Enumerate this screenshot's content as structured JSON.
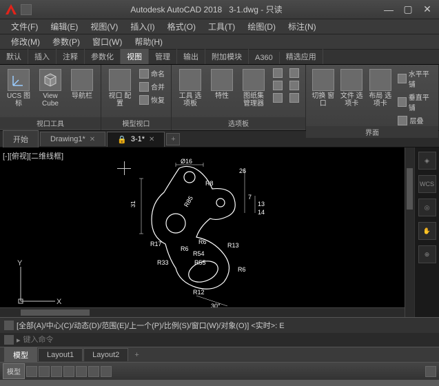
{
  "title": {
    "app": "Autodesk AutoCAD 2018",
    "file": "3-1.dwg",
    "mode": "只读"
  },
  "menus_row1": [
    "文件(F)",
    "编辑(E)",
    "视图(V)",
    "插入(I)",
    "格式(O)",
    "工具(T)",
    "绘图(D)",
    "标注(N)"
  ],
  "menus_row2": [
    "修改(M)",
    "参数(P)",
    "窗口(W)",
    "帮助(H)"
  ],
  "ribbon_tabs": [
    "默认",
    "插入",
    "注释",
    "参数化",
    "视图",
    "管理",
    "输出",
    "附加模块",
    "A360",
    "精选应用"
  ],
  "ribbon_active": 4,
  "panels": {
    "vptools": {
      "title": "视口工具",
      "ucs": "UCS\n图标",
      "viewcube": "View\nCube",
      "navbar": "导航栏"
    },
    "modelvp": {
      "title": "模型视口",
      "vpconf": "视口\n配置",
      "named": "命名",
      "join": "合并",
      "restore": "恢复"
    },
    "palettes": {
      "title": "选项板",
      "tool": "工具\n选项板",
      "props": "特性",
      "sheet": "图纸集\n管理器"
    },
    "ui": {
      "title": "界面",
      "switch": "切换\n窗口",
      "fileopt": "文件\n选项卡",
      "layoutopt": "布局\n选项卡",
      "htile": "水平平铺",
      "vtile": "垂直平铺",
      "cascade": "层叠"
    }
  },
  "file_tabs": [
    {
      "label": "开始",
      "closable": false
    },
    {
      "label": "Drawing1*",
      "closable": true
    },
    {
      "label": "3-1*",
      "closable": true,
      "active": true,
      "locked": true
    }
  ],
  "viewport_label": "[-][俯视][二维线框]",
  "wcs_label": "WCS",
  "axes": {
    "x": "X",
    "y": "Y"
  },
  "dims": {
    "d16": "Ø16",
    "r8": "R8",
    "v31": "31",
    "r17": "R17",
    "r33": "R33",
    "r6a": "R6",
    "r6b": "R6",
    "r54": "R54",
    "r55": "R55",
    "r85": "R85",
    "r12": "R12",
    "r13": "R13",
    "r6c": "R6",
    "v26": "26",
    "v7": "7",
    "v13": "13",
    "v14": "14",
    "ang30": "30°"
  },
  "cmd_history": "[全部(A)/中心(C)/动态(D)/范围(E)/上一个(P)/比例(S)/窗口(W)/对象(O)] <实时>: E",
  "cmd_prompt": "▸",
  "cmd_placeholder": "键入命令",
  "layout_tabs": [
    "模型",
    "Layout1",
    "Layout2"
  ],
  "status_model": "模型"
}
